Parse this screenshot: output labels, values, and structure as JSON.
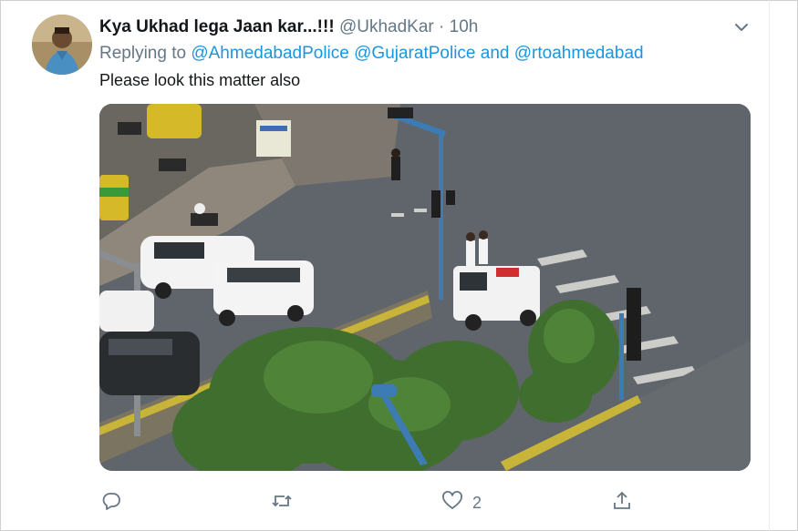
{
  "tweet": {
    "display_name": "Kya Ukhad lega Jaan kar...!!!",
    "handle": "@UkhadKar",
    "separator": "·",
    "time": "10h",
    "replying_prefix": "Replying to",
    "mentions": [
      "@AhmedabadPolice",
      "@GujaratPolice",
      "@rtoahmedabad"
    ],
    "and_word": "and",
    "text": "Please look this matter also"
  },
  "actions": {
    "reply_icon": "reply-icon",
    "retweet_icon": "retweet-icon",
    "like_icon": "like-icon",
    "like_count": "2",
    "share_icon": "share-icon"
  },
  "media": {
    "description_icon": "photo",
    "sign_text": ""
  }
}
